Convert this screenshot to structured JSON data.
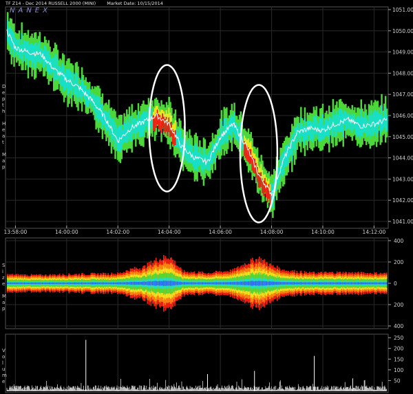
{
  "header": {
    "symbol": "TF Z14 - Dec 2014 RUSSELL 2000 (MINI)",
    "market_date": "Market Date: 10/15/2014",
    "brand": "NANEX"
  },
  "panels": {
    "depth_label": "Depth Heat Map",
    "size_label": "Size Map",
    "volume_label": "Volume"
  },
  "colors": {
    "background": "#000000",
    "grid": "#2a2a2a",
    "price_line": "#ffffff",
    "heat_low": "#18e0c8",
    "heat_mid": "#4cd838",
    "heat_high": "#f0e820",
    "heat_max": "#e82010",
    "annotation": "#ffffff"
  },
  "chart_data": [
    {
      "type": "heatmap",
      "title": "Depth Heat Map",
      "x_ticks": [
        "13:58:00",
        "14:00:00",
        "14:02:00",
        "14:04:00",
        "14:06:00",
        "14:08:00",
        "14:10:00",
        "14:12:00"
      ],
      "x_range": [
        "13:57:40",
        "14:12:30"
      ],
      "ylim": [
        1041,
        1051
      ],
      "y_ticks": [
        "1051.00",
        "1050.00",
        "1049.00",
        "1048.00",
        "1047.00",
        "1046.00",
        "1045.00",
        "1044.00",
        "1043.00",
        "1042.00",
        "1041.00"
      ],
      "price_series": {
        "time": [
          "13:57:40",
          "13:58:00",
          "13:58:30",
          "13:59:00",
          "13:59:30",
          "14:00:00",
          "14:00:30",
          "14:01:00",
          "14:01:30",
          "14:02:00",
          "14:02:30",
          "14:03:00",
          "14:03:30",
          "14:04:00",
          "14:04:30",
          "14:05:00",
          "14:05:30",
          "14:06:00",
          "14:06:30",
          "14:07:00",
          "14:07:30",
          "14:08:00",
          "14:08:30",
          "14:09:00",
          "14:09:30",
          "14:10:00",
          "14:10:30",
          "14:11:00",
          "14:11:30",
          "14:12:00",
          "14:12:30"
        ],
        "price": [
          1050.0,
          1049.2,
          1049.0,
          1048.9,
          1048.2,
          1047.7,
          1047.3,
          1046.7,
          1045.9,
          1044.8,
          1045.4,
          1045.7,
          1046.0,
          1045.6,
          1044.5,
          1044.0,
          1043.8,
          1045.0,
          1045.6,
          1044.6,
          1043.2,
          1042.3,
          1044.0,
          1045.2,
          1045.4,
          1045.3,
          1045.6,
          1045.8,
          1045.5,
          1045.6,
          1045.8
        ]
      },
      "annotations": [
        {
          "type": "ellipse",
          "time_center": "14:03:55",
          "price_center": 1045.4
        },
        {
          "type": "ellipse",
          "time_center": "14:07:30",
          "price_center": 1044.2
        }
      ]
    },
    {
      "type": "area",
      "title": "Size Map",
      "ylim": [
        -400,
        400
      ],
      "y_ticks": [
        "400",
        "200",
        "0",
        "200",
        "400"
      ],
      "envelope": {
        "time": [
          "13:57:40",
          "13:59:00",
          "14:00:30",
          "14:02:00",
          "14:02:30",
          "14:03:00",
          "14:03:30",
          "14:04:00",
          "14:04:30",
          "14:05:30",
          "14:06:30",
          "14:07:00",
          "14:07:30",
          "14:08:00",
          "14:08:30",
          "14:09:30",
          "14:10:30",
          "14:11:30",
          "14:12:30"
        ],
        "amplitude": [
          80,
          75,
          85,
          90,
          130,
          150,
          220,
          250,
          110,
          95,
          120,
          190,
          230,
          160,
          120,
          95,
          100,
          95,
          90
        ]
      }
    },
    {
      "type": "bar",
      "title": "Volume",
      "ylim": [
        0,
        260
      ],
      "y_ticks": [
        "250",
        "200",
        "150",
        "100",
        "50"
      ],
      "spikes": [
        {
          "time": "14:00:45",
          "value": 240
        },
        {
          "time": "14:09:40",
          "value": 165
        },
        {
          "time": "14:07:20",
          "value": 95
        },
        {
          "time": "14:05:30",
          "value": 80
        },
        {
          "time": "14:11:10",
          "value": 60
        }
      ],
      "baseline": 25
    }
  ]
}
